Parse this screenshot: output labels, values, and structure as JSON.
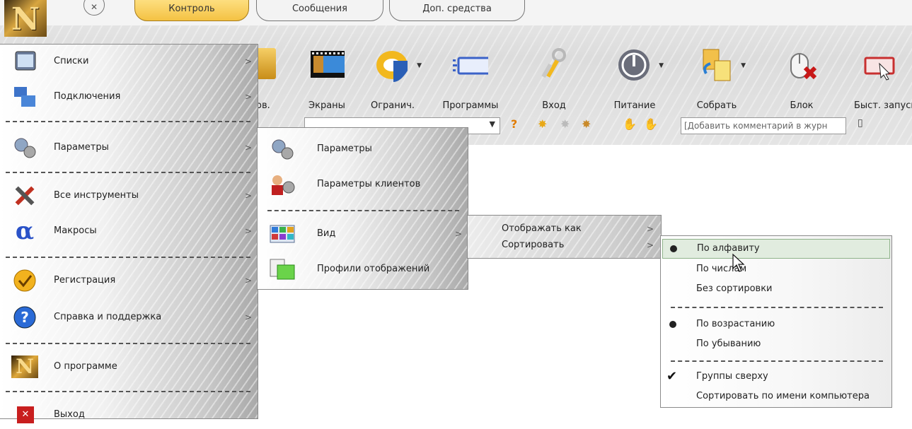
{
  "tabs": [
    "Контроль",
    "Сообщения",
    "Доп. средства"
  ],
  "toolbar": {
    "partial_label": "ов.",
    "items": [
      {
        "label": "Экраны",
        "icon": "screens-icon"
      },
      {
        "label": "Огранич.",
        "icon": "restrictions-icon"
      },
      {
        "label": "Программы",
        "icon": "programs-icon"
      },
      {
        "label": "Вход",
        "icon": "keys-icon"
      },
      {
        "label": "Питание",
        "icon": "power-icon"
      },
      {
        "label": "Собрать",
        "icon": "collect-icon"
      },
      {
        "label": "Блок",
        "icon": "block-mouse-icon"
      },
      {
        "label": "Быст. запуск",
        "icon": "quick-launch-icon"
      }
    ],
    "comment_placeholder": "[Добавить комментарий в журн"
  },
  "main_menu": {
    "items": [
      {
        "label": "Списки",
        "icon": "lists-icon"
      },
      {
        "label": "Подключения",
        "icon": "connections-icon"
      },
      {
        "label": "Параметры",
        "icon": "gears-icon"
      },
      {
        "label": "Все инструменты",
        "icon": "tools-icon"
      },
      {
        "label": "Макросы",
        "icon": "alpha-icon"
      },
      {
        "label": "Регистрация",
        "icon": "registration-check-icon"
      },
      {
        "label": "Справка и поддержка",
        "icon": "help-icon"
      },
      {
        "label": "О программе",
        "icon": "about-logo-icon"
      },
      {
        "label": "Выход",
        "icon": "exit-icon"
      }
    ]
  },
  "params_menu": {
    "items": [
      {
        "label": "Параметры",
        "icon": "gears-icon"
      },
      {
        "label": "Параметры клиентов",
        "icon": "client-settings-icon"
      },
      {
        "label": "Вид",
        "icon": "view-icon"
      },
      {
        "label": "Профили отображений",
        "icon": "display-profiles-icon"
      }
    ]
  },
  "view_menu": {
    "items": [
      "Отображать как",
      "Сортировать"
    ]
  },
  "sort_menu": {
    "items": [
      "По алфавиту",
      "По числам",
      "Без сортировки",
      "По возрастанию",
      "По убыванию",
      "Группы сверху",
      "Сортировать по имени компьютера"
    ]
  },
  "colors": {
    "accent_tab": "#f4c243",
    "highlight": "#e1ecdf"
  }
}
